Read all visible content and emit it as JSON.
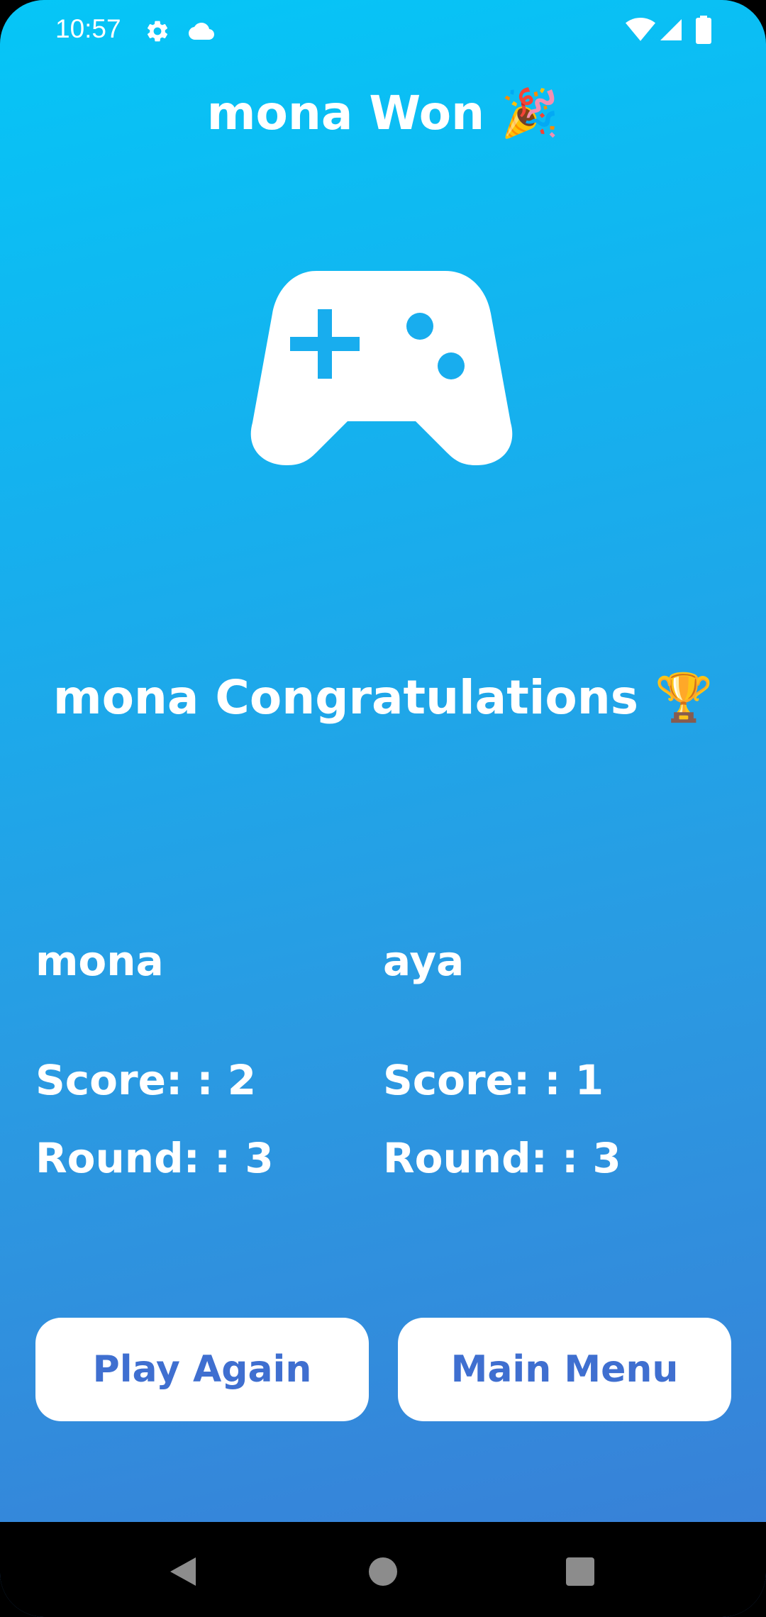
{
  "status_bar": {
    "time": "10:57",
    "icons": [
      "gear-icon",
      "cloud-icon",
      "wifi-icon",
      "signal-icon",
      "battery-icon"
    ]
  },
  "header": {
    "title": "mona Won 🎉"
  },
  "hero": {
    "icon": "gamepad-icon"
  },
  "result": {
    "message": "mona Congratulations 🏆"
  },
  "players": [
    {
      "name": "mona",
      "score": "Score: : 2",
      "round": "Round: : 3"
    },
    {
      "name": "aya",
      "score": "Score: : 1",
      "round": "Round: : 3"
    }
  ],
  "actions": {
    "play_again": "Play Again",
    "main_menu": "Main Menu"
  },
  "nav_bar": {
    "icons": [
      "back-icon",
      "home-icon",
      "recents-icon"
    ]
  },
  "colors": {
    "gradient_top": "#05C6F7",
    "gradient_bottom": "#3A7DD6",
    "button_text": "#3F6FD0",
    "button_bg": "#FFFFFF"
  }
}
